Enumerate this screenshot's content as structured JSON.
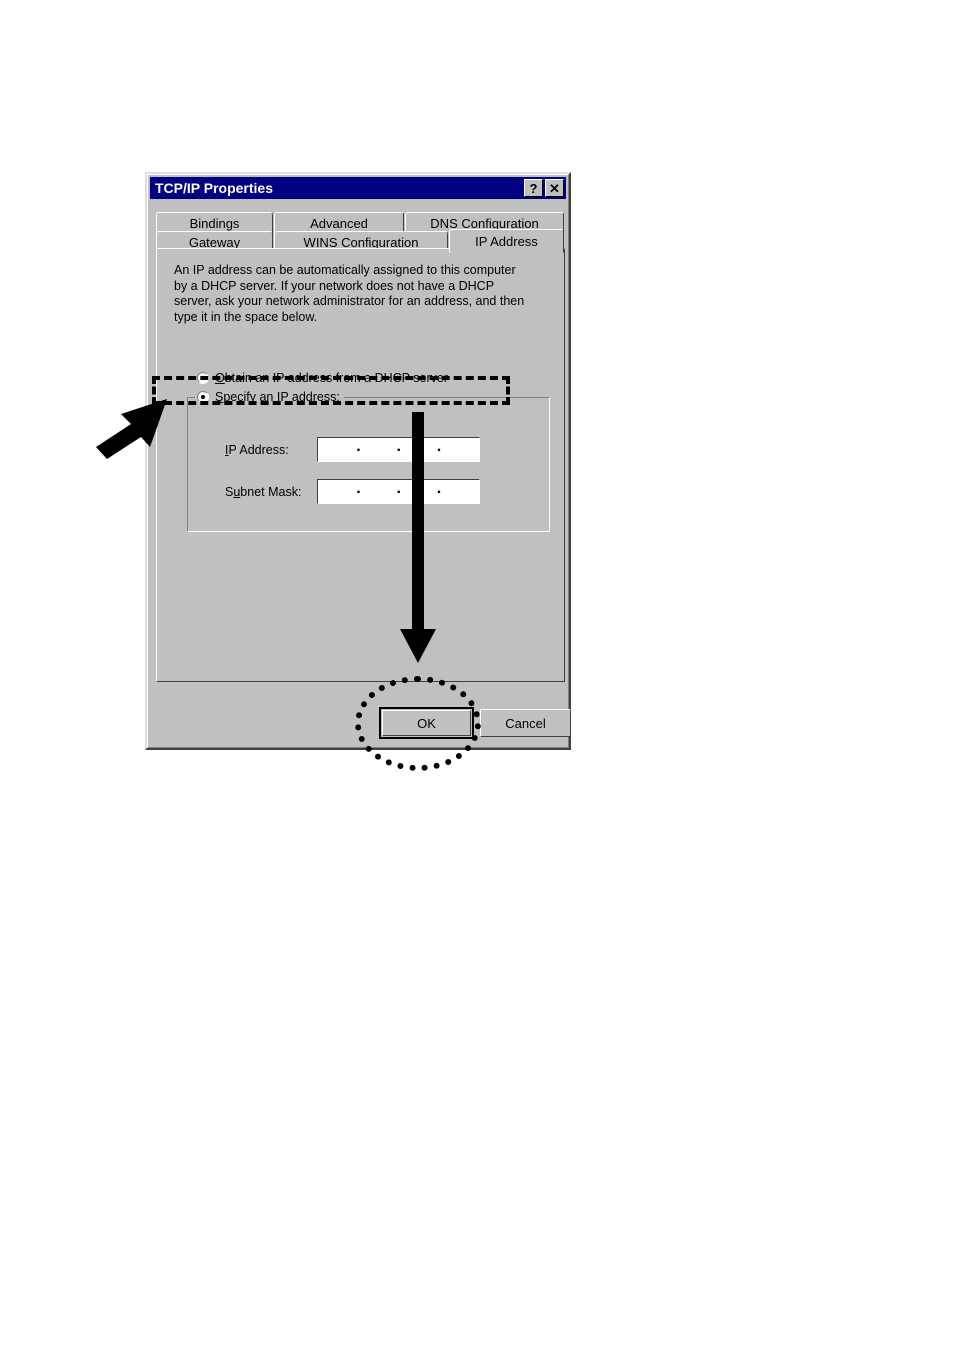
{
  "dialog": {
    "title": "TCP/IP Properties",
    "titlebar_buttons": [
      {
        "name": "help-button",
        "glyph": "?"
      },
      {
        "name": "close-button",
        "glyph": "✕"
      }
    ],
    "tabs_row1": [
      {
        "label": "Bindings",
        "active": false
      },
      {
        "label": "Advanced",
        "active": false
      },
      {
        "label": "DNS Configuration",
        "active": false
      }
    ],
    "tabs_row2": [
      {
        "label": "Gateway",
        "active": false
      },
      {
        "label": "WINS Configuration",
        "active": false
      },
      {
        "label": "IP Address",
        "active": true
      }
    ],
    "description": "An IP address can be automatically assigned to this computer\nby a DHCP server. If your network does not have a DHCP\nserver, ask your network administrator for an address, and then\ntype it in the space below.",
    "radio_dhcp": {
      "label_prefix": "",
      "label_underlined": "O",
      "label_rest": "btain an IP address from a DHCP server",
      "full_label": "Obtain an IP address from a DHCP server",
      "checked": false
    },
    "radio_specify": {
      "label_underlined": "S",
      "label_rest": "pecify an IP address:",
      "full_label": "Specify an IP address:",
      "checked": true
    },
    "fields": [
      {
        "name": "ip-address-field",
        "label_underlined": "I",
        "label_rest": "P Address:",
        "full_label": "IP Address:",
        "value": "",
        "octets": [
          "",
          "",
          "",
          ""
        ],
        "separator": "."
      },
      {
        "name": "subnet-mask-field",
        "label_prefix": "S",
        "label_underlined": "u",
        "label_rest": "bnet Mask:",
        "full_label": "Subnet Mask:",
        "value": "",
        "octets": [
          "",
          "",
          "",
          ""
        ],
        "separator": "."
      }
    ],
    "buttons": {
      "ok": "OK",
      "cancel": "Cancel"
    }
  },
  "annotations": {
    "pointer_arrow": "arrow pointing to Obtain an IP address from a DHCP server option",
    "flow_arrow": "arrow pointing down to OK button",
    "dhcp_highlight": "dashed rectangle highlight around DHCP radio option",
    "ok_highlight": "dotted ellipse highlight around OK button"
  },
  "colors": {
    "titlebar": "#000080",
    "face": "#c0c0c0",
    "highlight": "#ffffff",
    "shadow": "#808080",
    "dark_shadow": "#404040",
    "annotation": "#000000",
    "field_bg": "#ffffff"
  }
}
